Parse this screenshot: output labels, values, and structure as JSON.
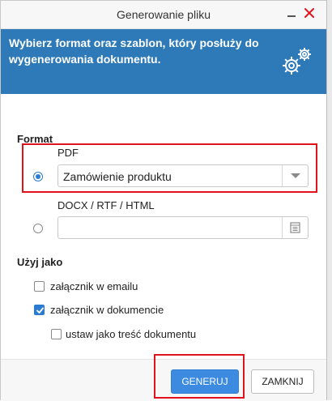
{
  "dialog": {
    "title": "Generowanie pliku",
    "banner_text": "Wybierz format oraz szablon, który posłuży do wygenerowania dokumentu.",
    "banner_color": "#2e7ab8",
    "banner_icon": "gears-icon"
  },
  "format": {
    "label": "Format",
    "options": [
      {
        "label": "PDF",
        "selected": true,
        "field_value": "Zamówienie produktu",
        "field_icon": "chevron-down-icon"
      },
      {
        "label": "DOCX / RTF / HTML",
        "selected": false,
        "field_value": "",
        "field_icon": "document-icon"
      }
    ]
  },
  "use_as": {
    "label": "Użyj jako",
    "items": [
      {
        "label": "załącznik w emailu",
        "checked": false
      },
      {
        "label": "załącznik w dokumencie",
        "checked": true
      },
      {
        "label": "ustaw jako treść dokumentu",
        "checked": false
      }
    ]
  },
  "buttons": {
    "generate": "GENERUJ",
    "close": "ZAMKNIJ",
    "primary_color": "#3d8be0"
  },
  "highlight_color": "#e0131b"
}
